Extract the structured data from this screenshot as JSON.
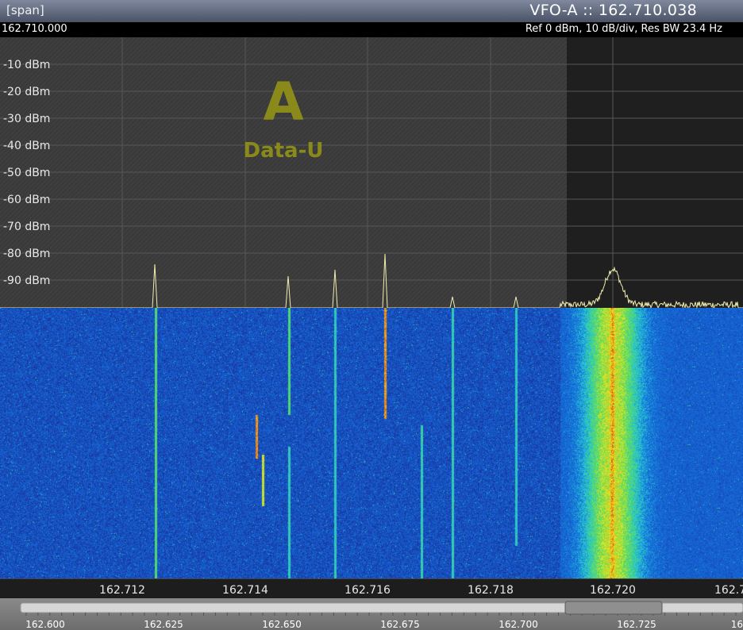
{
  "titlebar": {
    "span_label": "[span]",
    "vfo_label": "VFO-A  ::  162.710.038"
  },
  "infobar": {
    "center_freq": "162.710.000",
    "ref_info": "Ref 0 dBm,  10 dB/div,  Res BW 23.4 Hz"
  },
  "spectrum": {
    "db_labels": [
      "-10 dBm",
      "-20 dBm",
      "-30 dBm",
      "-40 dBm",
      "-50 dBm",
      "-60 dBm",
      "-70 dBm",
      "-80 dBm",
      "-90 dBm"
    ],
    "mode_letter": "A",
    "mode_name": "Data-U"
  },
  "freq_axis": {
    "labels": [
      "162.712",
      "162.714",
      "162.716",
      "162.718",
      "162.720",
      "162.7"
    ]
  },
  "scroll_scale": {
    "labels": [
      "162.600",
      "162.625",
      "162.650",
      "162.675",
      "162.700",
      "162.725",
      "16"
    ]
  },
  "colors": {
    "trace": "#f2ecb0",
    "mode_overlay": "#8a8a1a",
    "waterfall_bg": "#1e3fa8",
    "titlebar": "#5e677d"
  }
}
